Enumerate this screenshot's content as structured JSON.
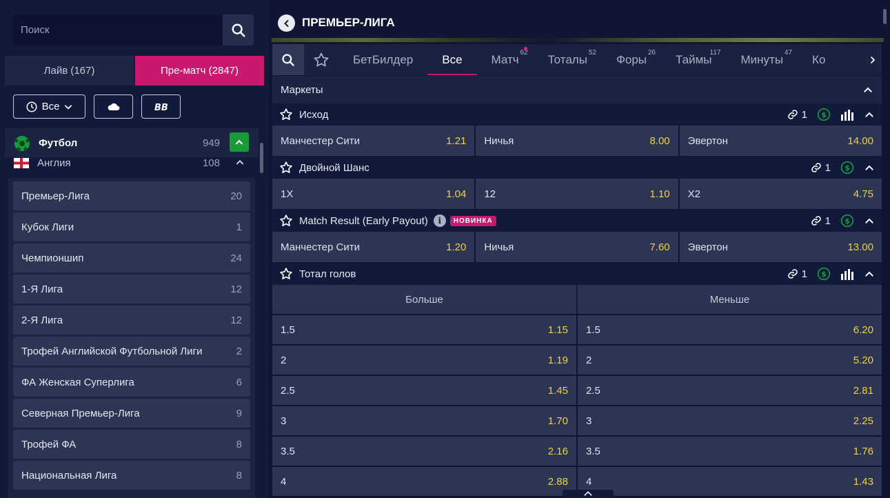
{
  "sidebar": {
    "search_placeholder": "Поиск",
    "tabs": [
      {
        "label": "Лайв (167)"
      },
      {
        "label": "Пре-матч (2847)"
      }
    ],
    "filter_all_label": "Все",
    "sport": {
      "name": "Футбол",
      "count": "949"
    },
    "country": {
      "name": "Англия",
      "count": "108"
    },
    "leagues": [
      {
        "name": "Премьер-Лига",
        "count": "20"
      },
      {
        "name": "Кубок Лиги",
        "count": "1"
      },
      {
        "name": "Чемпионшип",
        "count": "24"
      },
      {
        "name": "1-Я Лига",
        "count": "12"
      },
      {
        "name": "2-Я Лига",
        "count": "12"
      },
      {
        "name": "Трофей Английской Футбольной Лиги",
        "count": "2"
      },
      {
        "name": "ФА Женская Суперлига",
        "count": "6"
      },
      {
        "name": "Северная Премьер-Лига",
        "count": "9"
      },
      {
        "name": "Трофей ФА",
        "count": "8"
      },
      {
        "name": "Национальная Лига",
        "count": "8"
      }
    ]
  },
  "header": {
    "title": "ПРЕМЬЕР-ЛИГА"
  },
  "market_tabs": [
    {
      "label": "БетБилдер",
      "count": ""
    },
    {
      "label": "Все",
      "count": ""
    },
    {
      "label": "Матч",
      "count": "62"
    },
    {
      "label": "Тоталы",
      "count": "52"
    },
    {
      "label": "Форы",
      "count": "26"
    },
    {
      "label": "Таймы",
      "count": "117"
    },
    {
      "label": "Минуты",
      "count": "47"
    },
    {
      "label": "Ко",
      "count": ""
    }
  ],
  "markets_title": "Маркеты",
  "markets": [
    {
      "name": "Исход",
      "links": "1",
      "outcomes": [
        {
          "label": "Манчестер Сити",
          "odd": "1.21"
        },
        {
          "label": "Ничья",
          "odd": "8.00"
        },
        {
          "label": "Эвертон",
          "odd": "14.00"
        }
      ]
    },
    {
      "name": "Двойной Шанс",
      "links": "1",
      "outcomes": [
        {
          "label": "1X",
          "odd": "1.04"
        },
        {
          "label": "12",
          "odd": "1.10"
        },
        {
          "label": "X2",
          "odd": "4.75"
        }
      ]
    },
    {
      "name": "Match Result (Early Payout)",
      "badge": "НОВИНКА",
      "info": "i",
      "links": "1",
      "outcomes": [
        {
          "label": "Манчестер Сити",
          "odd": "1.20"
        },
        {
          "label": "Ничья",
          "odd": "7.60"
        },
        {
          "label": "Эвертон",
          "odd": "13.00"
        }
      ]
    }
  ],
  "totals": {
    "name": "Тотал голов",
    "links": "1",
    "over_label": "Больше",
    "under_label": "Меньше",
    "rows": [
      {
        "line": "1.5",
        "over": "1.15",
        "under": "6.20"
      },
      {
        "line": "2",
        "over": "1.19",
        "under": "5.20"
      },
      {
        "line": "2.5",
        "over": "1.45",
        "under": "2.81"
      },
      {
        "line": "3",
        "over": "1.70",
        "under": "2.25"
      },
      {
        "line": "3.5",
        "over": "2.16",
        "under": "1.76"
      },
      {
        "line": "4",
        "over": "2.88",
        "under": "1.43"
      }
    ]
  },
  "colors": {
    "accent": "#c8196f",
    "odds": "#f1d23a",
    "green": "#1a9a3a"
  }
}
